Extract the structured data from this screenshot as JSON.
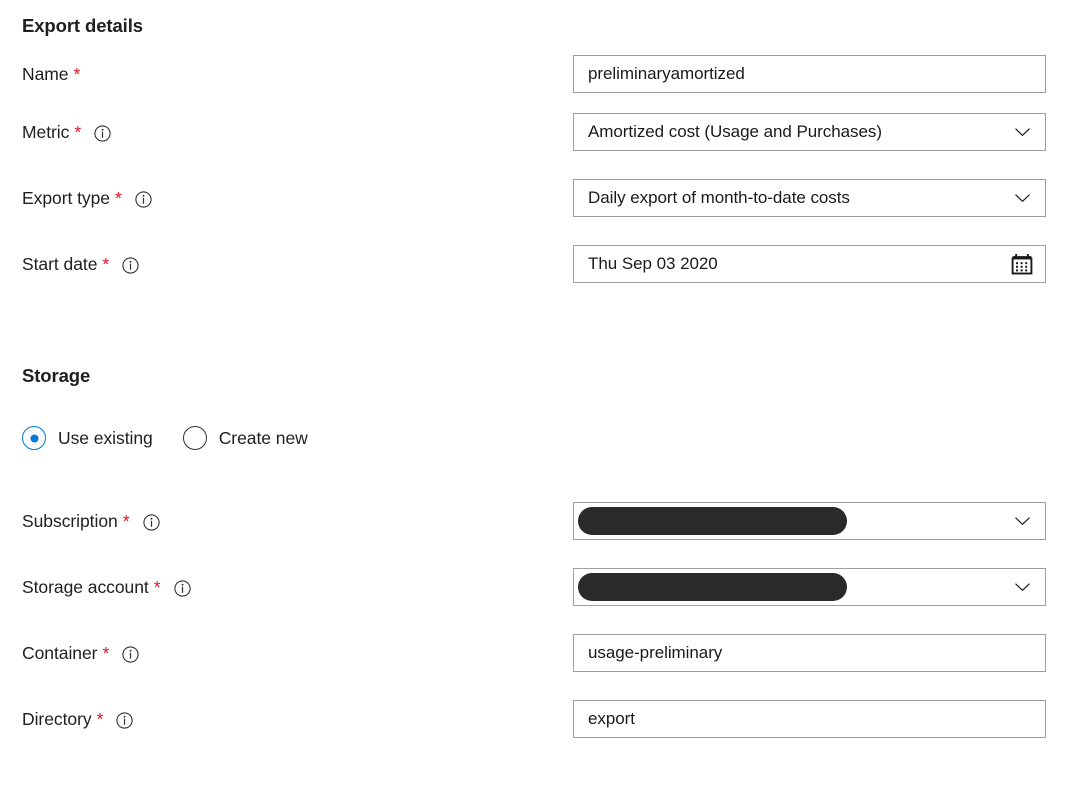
{
  "sections": {
    "export_details": {
      "heading": "Export details"
    },
    "storage": {
      "heading": "Storage"
    }
  },
  "fields": {
    "name": {
      "label": "Name",
      "required": "*",
      "value": "preliminaryamortized",
      "placeholder": "",
      "has_info": false
    },
    "metric": {
      "label": "Metric",
      "required": "*",
      "value": "Amortized cost (Usage and Purchases)",
      "has_info": true,
      "chevron": "chevron-down-icon"
    },
    "export_type": {
      "label": "Export type",
      "required": "*",
      "value": "Daily export of month-to-date costs",
      "has_info": true,
      "chevron": "chevron-down-icon"
    },
    "start_date": {
      "label": "Start date",
      "required": "*",
      "value": "Thu Sep 03 2020",
      "has_info": true,
      "icon": "calendar-icon"
    },
    "subscription": {
      "label": "Subscription",
      "required": "*",
      "value": "",
      "redacted": true,
      "has_info": true,
      "chevron": "chevron-down-icon"
    },
    "storage_account": {
      "label": "Storage account",
      "required": "*",
      "value": "",
      "redacted": true,
      "has_info": true,
      "chevron": "chevron-down-icon"
    },
    "container": {
      "label": "Container",
      "required": "*",
      "value": "usage-preliminary",
      "has_info": true
    },
    "directory": {
      "label": "Directory",
      "required": "*",
      "value": "export",
      "has_info": true
    }
  },
  "storage_mode": {
    "options": [
      {
        "label": "Use existing",
        "selected": true
      },
      {
        "label": "Create new",
        "selected": false
      }
    ]
  },
  "colors": {
    "accent": "#0078d4",
    "required_asterisk": "#e81123",
    "text": "#201f1e",
    "border": "#a19f9d",
    "redaction": "#2b2a2a"
  }
}
